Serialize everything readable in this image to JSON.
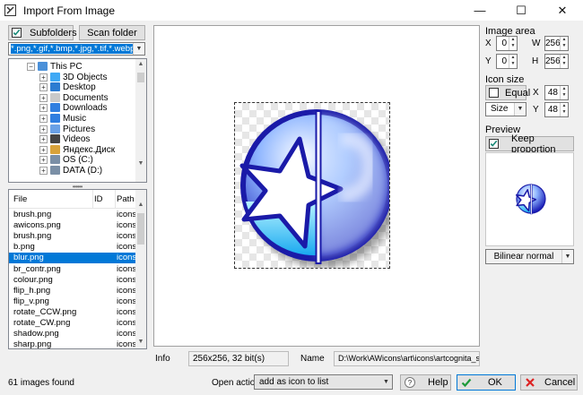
{
  "window": {
    "title": "Import From Image",
    "minimize_glyph": "—",
    "maximize_glyph": "☐",
    "close_glyph": "✕"
  },
  "left": {
    "subfolders_label": "Subfolders",
    "scan_label": "Scan folder",
    "filter_value": "*.png,*.gif,*.bmp,*.jpg,*.tif,*.webp,*",
    "tree": [
      {
        "label": "This PC",
        "icon": "computer-icon",
        "level": 0,
        "expander": "−"
      },
      {
        "label": "3D Objects",
        "icon": "3d-objects-icon",
        "level": 1,
        "expander": "+"
      },
      {
        "label": "Desktop",
        "icon": "desktop-icon",
        "level": 1,
        "expander": "+"
      },
      {
        "label": "Documents",
        "icon": "documents-icon",
        "level": 1,
        "expander": "+"
      },
      {
        "label": "Downloads",
        "icon": "downloads-icon",
        "level": 1,
        "expander": "+"
      },
      {
        "label": "Music",
        "icon": "music-icon",
        "level": 1,
        "expander": "+"
      },
      {
        "label": "Pictures",
        "icon": "pictures-icon",
        "level": 1,
        "expander": "+"
      },
      {
        "label": "Videos",
        "icon": "videos-icon",
        "level": 1,
        "expander": "+"
      },
      {
        "label": "Яндекс.Диск",
        "icon": "yandex-disk-icon",
        "level": 1,
        "expander": "+"
      },
      {
        "label": "OS (C:)",
        "icon": "drive-c-icon",
        "level": 1,
        "expander": "+"
      },
      {
        "label": "DATA (D:)",
        "icon": "drive-d-icon",
        "level": 1,
        "expander": "+"
      }
    ],
    "list_headers": [
      "File",
      "ID",
      "Path"
    ],
    "files": [
      {
        "file": "brush.png",
        "path": "icons\\"
      },
      {
        "file": "awicons.png",
        "path": "icons\\"
      },
      {
        "file": "brush.png",
        "path": "icons\\"
      },
      {
        "file": "b.png",
        "path": "icons\\"
      },
      {
        "file": "blur.png",
        "path": "icons\\",
        "selected": true
      },
      {
        "file": "br_contr.png",
        "path": "icons\\"
      },
      {
        "file": "colour.png",
        "path": "icons\\"
      },
      {
        "file": "flip_h.png",
        "path": "icons\\"
      },
      {
        "file": "flip_v.png",
        "path": "icons\\"
      },
      {
        "file": "rotate_CCW.png",
        "path": "icons\\"
      },
      {
        "file": "rotate_CW.png",
        "path": "icons\\"
      },
      {
        "file": "shadow.png",
        "path": "icons\\"
      },
      {
        "file": "sharp.png",
        "path": "icons\\"
      }
    ]
  },
  "info": {
    "label": "Info",
    "value": "256x256, 32 bit(s)",
    "name_label": "Name",
    "name_value": "D:\\Work\\AWicons\\art\\icons\\artcognita_src\\B"
  },
  "right": {
    "image_area_label": "Image area",
    "x_label": "X",
    "x_value": "0",
    "w_label": "W",
    "w_value": "256",
    "y_label": "Y",
    "y_value": "0",
    "h_label": "H",
    "h_value": "256",
    "icon_size_label": "Icon size",
    "equal_label": "Equal",
    "size_value": "Size",
    "ix_label": "X",
    "ix_value": "48",
    "iy_label": "Y",
    "iy_value": "48",
    "preview_label": "Preview",
    "keep_label": "Keep proportion",
    "resample_value": "Bilinear normal"
  },
  "bottom": {
    "status": "61 images found",
    "open_action_label": "Open action",
    "open_action_value": "add as icon to list",
    "help_label": "Help",
    "ok_label": "OK",
    "cancel_label": "Cancel"
  },
  "colors": {
    "accent": "#0078d7",
    "check": "#1d8c7a"
  }
}
